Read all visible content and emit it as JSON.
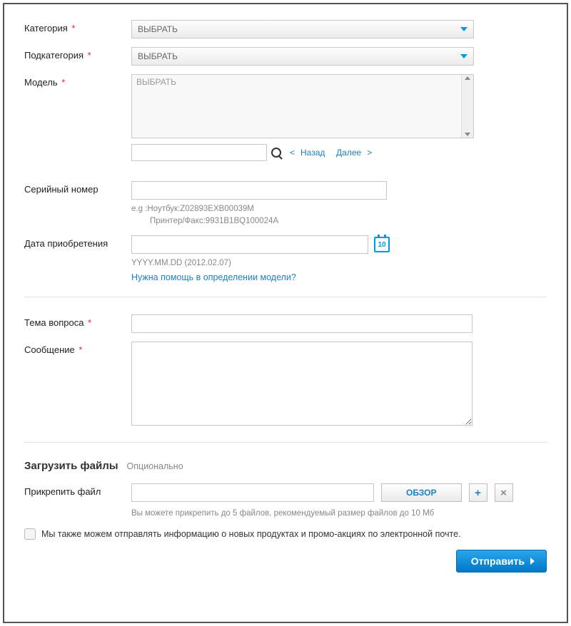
{
  "form": {
    "category": {
      "label": "Категория",
      "required": true,
      "value": "ВЫБРАТЬ"
    },
    "subcategory": {
      "label": "Подкатегория",
      "required": true,
      "value": "ВЫБРАТЬ"
    },
    "model": {
      "label": "Модель",
      "required": true,
      "placeholder": "ВЫБРАТЬ"
    },
    "search": {
      "prev": "Назад",
      "next": "Далее"
    },
    "serial": {
      "label": "Серийный номер",
      "hint1": "e.g :Ноутбук:Z02893EXB00039M",
      "hint2": "Принтер/Факс:9931B1BQ100024A"
    },
    "purchase_date": {
      "label": "Дата приобретения",
      "hint": "YYYY.MM.DD (2012.02.07)",
      "help_link": "Нужна помощь в определении модели?",
      "cal_day": "10"
    },
    "subject": {
      "label": "Тема вопроса",
      "required": true
    },
    "message": {
      "label": "Сообщение",
      "required": true
    }
  },
  "upload": {
    "title": "Загрузить файлы",
    "optional": "Опционально",
    "attach_label": "Прикрепить файл",
    "browse": "ОБЗОР",
    "add": "+",
    "remove": "×",
    "hint": "Вы можете прикрепить до 5 файлов, рекомендуемый размер файлов до 10 Мб"
  },
  "consent": {
    "text": "Мы также можем отправлять информацию о новых продуктах и промо-акциях по электронной почте."
  },
  "submit": {
    "label": "Отправить"
  }
}
